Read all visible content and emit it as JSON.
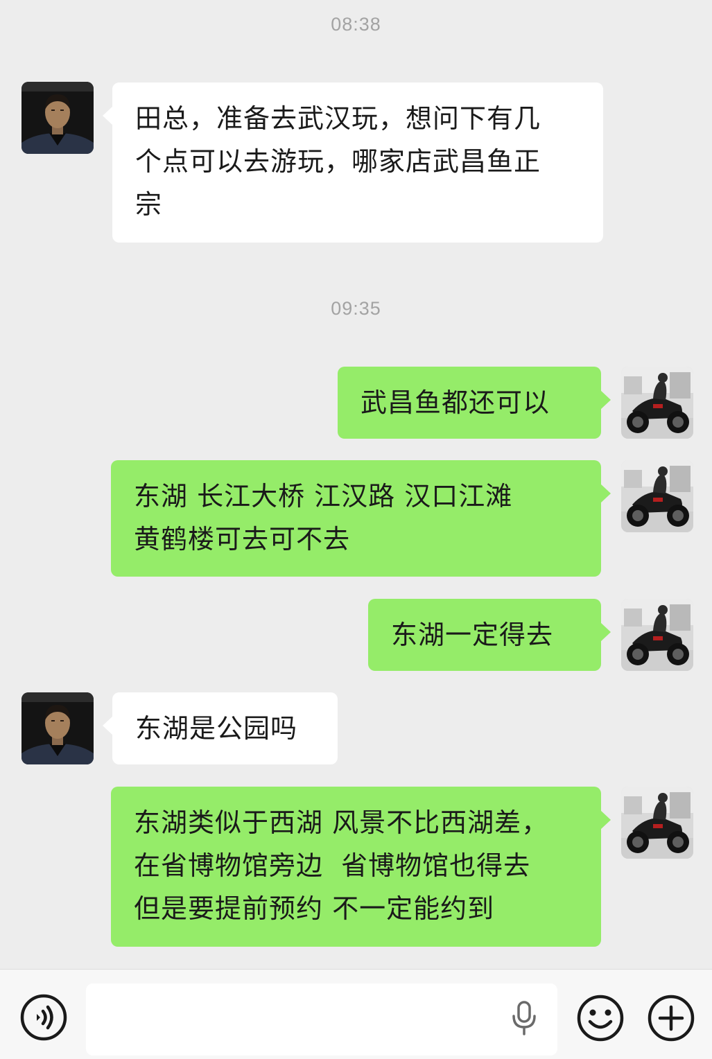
{
  "chat": {
    "timestamps": [
      "08:38",
      "09:35"
    ],
    "messages": [
      {
        "from": "contact",
        "text": "田总，准备去武汉玩，想问下有几\n个点可以去游玩，哪家店武昌鱼正\n宗"
      },
      {
        "from": "me",
        "text": "武昌鱼都还可以"
      },
      {
        "from": "me",
        "text": "东湖 长江大桥 江汉路 汉口江滩\n黄鹤楼可去可不去"
      },
      {
        "from": "me",
        "text": "东湖一定得去"
      },
      {
        "from": "contact",
        "text": "东湖是公园吗"
      },
      {
        "from": "me",
        "text": "东湖类似于西湖 风景不比西湖差，\n在省博物馆旁边  省博物馆也得去\n但是要提前预约 不一定能约到"
      }
    ]
  },
  "input_bar": {
    "input_value": "",
    "icons": [
      "voice-toggle-icon",
      "microphone-icon",
      "emoji-icon",
      "add-icon"
    ]
  },
  "colors": {
    "background": "#ededed",
    "incoming_bubble": "#ffffff",
    "outgoing_bubble": "#95ec69",
    "timestamp": "#a3a3a3"
  }
}
